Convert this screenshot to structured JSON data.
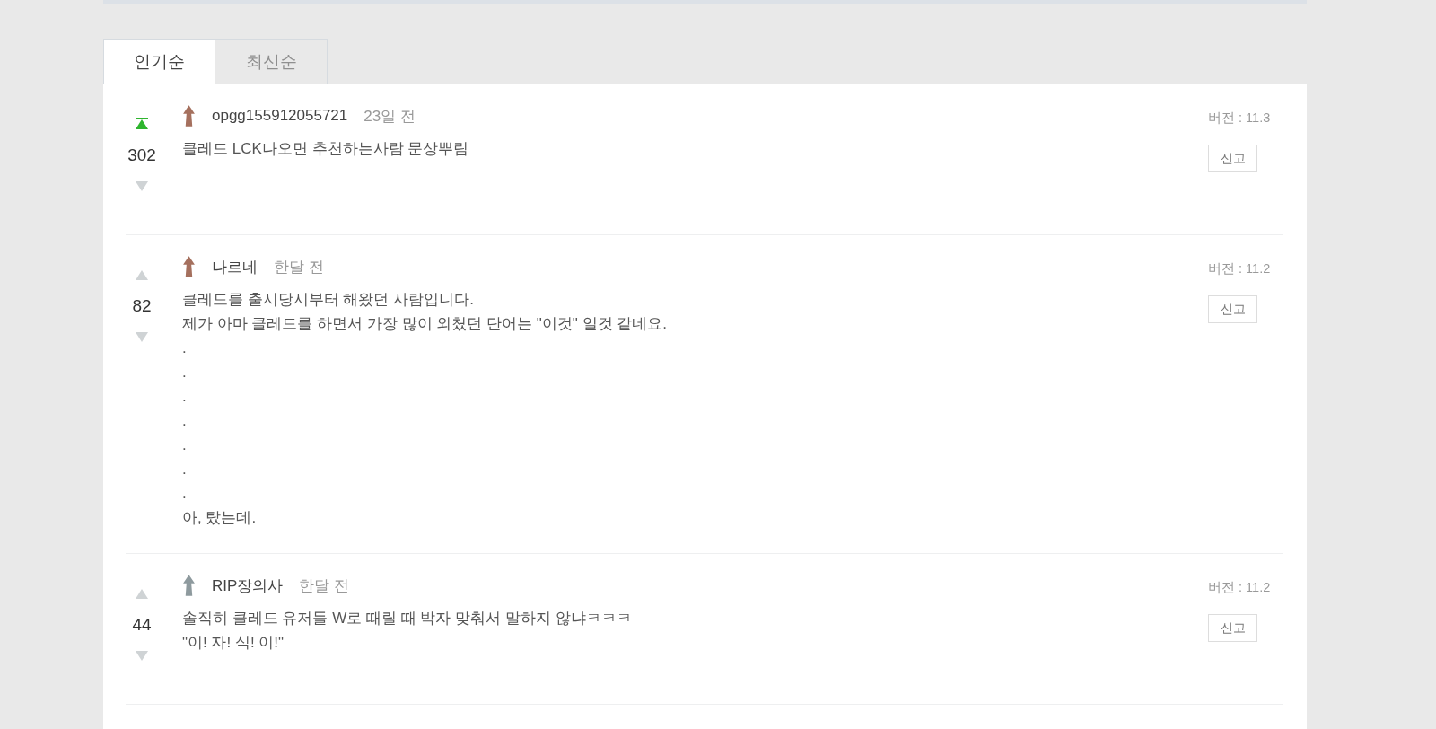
{
  "tabs": [
    {
      "label": "인기순",
      "selected": true
    },
    {
      "label": "최신순",
      "selected": false
    }
  ],
  "comments": [
    {
      "upvoted": true,
      "votes": "302",
      "color": "#a5705e",
      "author": "opgg155912055721",
      "time": "23일 전",
      "body": "클레드 LCK나오면 추천하는사람 문상뿌림",
      "version": "버전 : 11.3",
      "report": "신고"
    },
    {
      "upvoted": false,
      "votes": "82",
      "color": "#a5705e",
      "author": "나르네",
      "time": "한달 전",
      "body": "클레드를 출시당시부터 해왔던 사람입니다.\n제가 아마 클레드를 하면서 가장 많이 외쳤던 단어는 \"이것\" 일것 같네요.\n.\n.\n.\n.\n.\n.\n.\n아, 탔는데.",
      "version": "버전 : 11.2",
      "report": "신고"
    },
    {
      "upvoted": false,
      "votes": "44",
      "color": "#8e9a9e",
      "author": "RIP장의사",
      "time": "한달 전",
      "body": "솔직히 클레드 유저들 W로 때릴 때 박자 맞춰서 말하지 않냐ㅋㅋㅋ\n\"이! 자! 식! 이!\"",
      "version": "버전 : 11.2",
      "report": "신고"
    }
  ]
}
